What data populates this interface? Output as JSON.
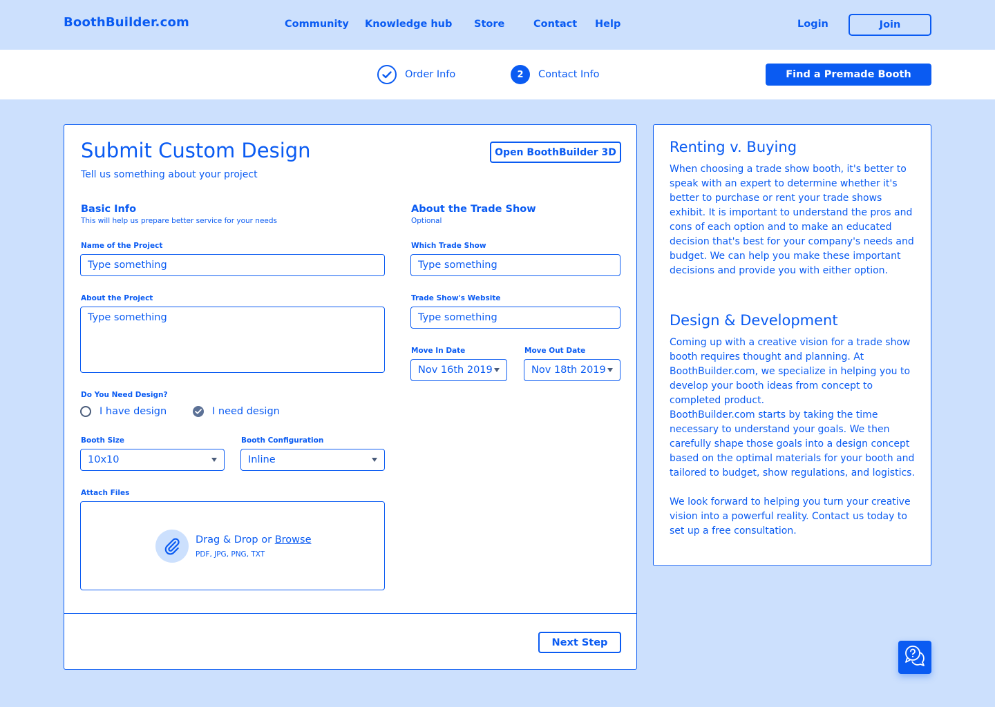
{
  "header": {
    "brand": "BoothBuilder.com",
    "nav": [
      "Community",
      "Knowledge hub",
      "Store",
      "Contact",
      "Help"
    ],
    "login": "Login",
    "join": "Join"
  },
  "steps": {
    "items": [
      {
        "label": "Order Info",
        "state": "done"
      },
      {
        "label": "Contact Info",
        "number": "2",
        "state": "current"
      }
    ],
    "premade_button": "Find a Premade Booth"
  },
  "form": {
    "title": "Submit Custom Design",
    "subtitle": "Tell us something about your project",
    "open3d_button": "Open BoothBuilder 3D",
    "basic": {
      "title": "Basic Info",
      "note": "This will help us prepare better service for your needs",
      "project_name_label": "Name of the Project",
      "project_name_placeholder": "Type something",
      "about_label": "About the Project",
      "about_placeholder": "Type something",
      "design_question": "Do You Need Design?",
      "design_options": [
        "I have design",
        "I need design"
      ],
      "design_selected": "I need design",
      "size_label": "Booth Size",
      "size_value": "10x10",
      "config_label": "Booth Configuration",
      "config_value": "Inline",
      "attach_label": "Attach Files",
      "drop_text": "Drag & Drop or ",
      "browse_text": "Browse",
      "formats": "PDF, JPG, PNG, TXT"
    },
    "tradeshow": {
      "title": "About the Trade Show",
      "note": "Optional",
      "which_label": "Which Trade Show",
      "which_placeholder": "Type something",
      "website_label": "Trade Show's Website",
      "website_placeholder": "Type something",
      "move_in_label": "Move In Date",
      "move_in_value": "Nov 16th 2019",
      "move_out_label": "Move Out Date",
      "move_out_value": "Nov 18th 2019"
    },
    "next_button": "Next Step"
  },
  "sidebar": {
    "renting_title": "Renting v. Buying",
    "renting_text": "When choosing a trade show booth, it's better to speak with an expert to determine whether it's better to purchase or rent your trade shows exhibit. It is important to understand the pros and cons of each option and to make an educated decision that's best for your company's needs and budget. We can help you make these important decisions and provide you with either option.",
    "design_title": "Design & Development",
    "design_text_1": "Coming up with a creative vision for a trade show booth requires thought and planning. At BoothBuilder.com, we specialize in helping you to develop your booth ideas from concept to completed product.",
    "design_text_2": "BoothBuilder.com starts by taking the time necessary to understand your goals. We then carefully shape those goals into a design concept based on the optimal materials for your booth and tailored to budget, show regulations, and logistics.",
    "design_text_3": "We look forward to helping you turn your creative vision into a powerful reality. Contact us today to set up a free consultation."
  },
  "colors": {
    "accent": "#0a5bf2",
    "background": "#cce0fd",
    "card": "#ffffff",
    "radio_checked": "#5c7196"
  },
  "icons": [
    "check-circle-icon",
    "paperclip-icon",
    "chat-help-icon",
    "caret-down-icon"
  ]
}
